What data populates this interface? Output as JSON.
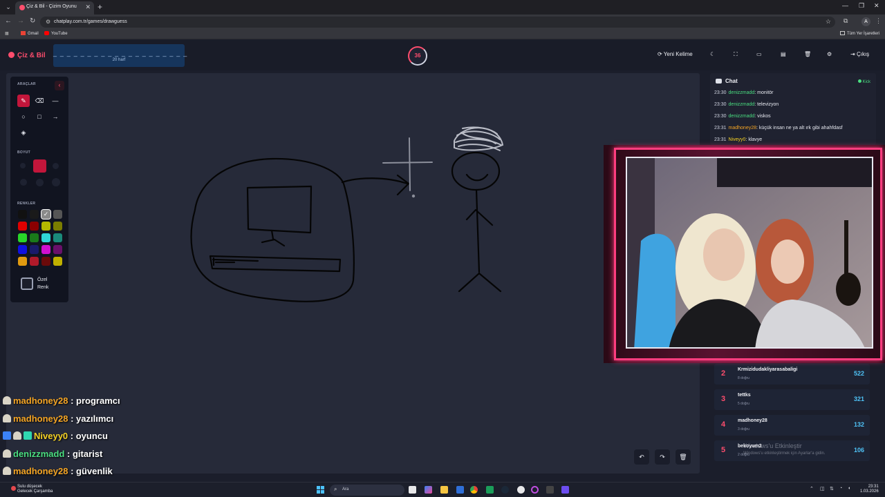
{
  "browser": {
    "tab_title": "Çiz & Bil - Çizim Oyunu",
    "url": "chatplay.com.tr/games/drawguess",
    "bookmarks": [
      "Gmail",
      "YouTube"
    ],
    "all_bookmarks": "Tüm Yer İşaretleri",
    "profile_initial": "A"
  },
  "game": {
    "logo": "Çiz & Bil",
    "word_hint": "_ _ _ _ _ _ _ _ _ _ _ _ _ _ _ _ _ _ _ _",
    "word_length": "20 harf",
    "timer": "36",
    "new_word": "Yeni Kelime",
    "exit": "Çıkış"
  },
  "tools": {
    "tools_title": "ARAÇLAR",
    "size_title": "BOYUT",
    "colors_title": "RENKLER",
    "custom_color": "Özel Renk",
    "swatches": [
      "#111111",
      "#1a1a1a",
      "#8a8a8a",
      "#555555",
      "#e00000",
      "#8b0000",
      "#b5b800",
      "#7b7d00",
      "#29d629",
      "#1a7a1a",
      "#2fd6d6",
      "#1a8a7a",
      "#1010e0",
      "#1a1a6a",
      "#d010d0",
      "#6a106a",
      "#e09a10",
      "#b01a2a",
      "#6a0a0a",
      "#c0b000"
    ]
  },
  "chat": {
    "title": "Chat",
    "platform": "Kick",
    "messages": [
      {
        "time": "23:30",
        "user": "denizzmadd",
        "text": ": monitör",
        "color": "#4ade80"
      },
      {
        "time": "23:30",
        "user": "denizzmadd",
        "text": ": televizyon",
        "color": "#4ade80"
      },
      {
        "time": "23:30",
        "user": "denizzmadd",
        "text": ": viskos",
        "color": "#4ade80"
      },
      {
        "time": "23:31",
        "user": "madhoney28",
        "text": ": küçük insan ne ya alt ırk gibi ahahfdasf",
        "color": "#f5a524"
      },
      {
        "time": "23:31",
        "user": "Niveyy0",
        "text": ": klavye",
        "color": "#f5d224"
      }
    ]
  },
  "scoreboard": [
    {
      "rank": "2",
      "name": "Krmizidudakliyarasabaligi",
      "sub": "8 doğru",
      "points": "522"
    },
    {
      "rank": "3",
      "name": "tettks",
      "sub": "5 doğru",
      "points": "321"
    },
    {
      "rank": "4",
      "name": "madhoney28",
      "sub": "3 doğru",
      "points": "132"
    },
    {
      "rank": "5",
      "name": "bekoyum2",
      "sub": "2 doğru",
      "points": "106"
    }
  ],
  "watermark": {
    "title": "Windows'u Etkinleştir",
    "sub": "Windows'u etkinleştirmek için Ayarlar'a gidin."
  },
  "overlay_chat": [
    {
      "user": "madhoney28",
      "msg": " : programcı",
      "color": "#f5a524"
    },
    {
      "user": "madhoney28",
      "msg": " : yazılımcı",
      "color": "#f5a524"
    },
    {
      "user": "Niveyy0",
      "msg": " : oyuncu",
      "color": "#f5d224"
    },
    {
      "user": "denizzmadd",
      "msg": " : gitarist",
      "color": "#4ade80"
    },
    {
      "user": "madhoney28",
      "msg": " : güvenlik",
      "color": "#f5a524"
    }
  ],
  "taskbar": {
    "weather_line1": "Sulu düşecek",
    "weather_line2": "Gelecek Çarşamba",
    "search_placeholder": "Ara",
    "time": "23:31",
    "date": "1.03.2026"
  }
}
